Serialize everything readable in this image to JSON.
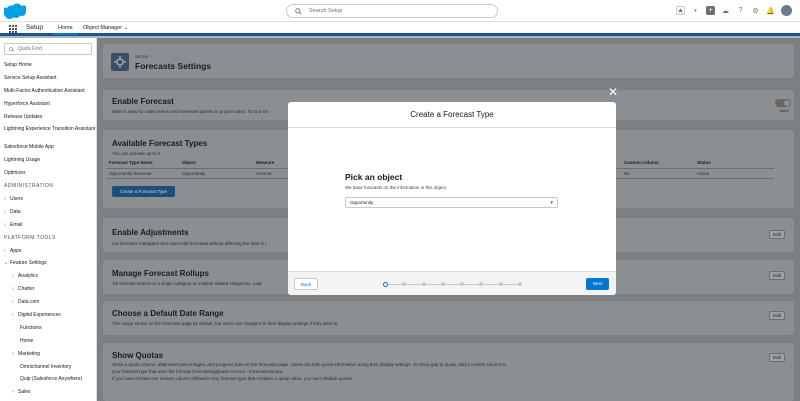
{
  "header": {
    "search_placeholder": "Search Setup"
  },
  "context_bar": {
    "app_name": "Setup",
    "tabs": [
      {
        "label": "Home"
      },
      {
        "label": "Object Manager"
      }
    ]
  },
  "sidebar": {
    "quick_find_placeholder": "Quick Find",
    "items": [
      {
        "label": "Setup Home"
      },
      {
        "label": "Service Setup Assistant"
      },
      {
        "label": "Multi-Factor Authentication Assistant"
      },
      {
        "label": "Hyperforce Assistant"
      },
      {
        "label": "Release Updates"
      },
      {
        "label": "Lightning Experience Transition Assistant"
      },
      {
        "label": "Salesforce Mobile App"
      },
      {
        "label": "Lightning Usage"
      },
      {
        "label": "Optimizer"
      }
    ],
    "section_admin": "ADMINISTRATION",
    "admin_items": [
      {
        "label": "Users"
      },
      {
        "label": "Data"
      },
      {
        "label": "Email"
      }
    ],
    "section_platform": "PLATFORM TOOLS",
    "platform_items": [
      {
        "label": "Apps"
      },
      {
        "label": "Feature Settings"
      }
    ],
    "feature_items": [
      {
        "label": "Analytics"
      },
      {
        "label": "Chatter"
      },
      {
        "label": "Data.com"
      },
      {
        "label": "Digital Experiences"
      },
      {
        "label": "Functions"
      },
      {
        "label": "Home"
      },
      {
        "label": "Marketing"
      },
      {
        "label": "Omnichannel Inventory"
      },
      {
        "label": "Quip (Salesforce Anywhere)"
      },
      {
        "label": "Sales"
      }
    ]
  },
  "page": {
    "kicker": "SETUP",
    "title": "Forecasts Settings"
  },
  "sections": {
    "enable_forecast": {
      "title": "Enable Forecast",
      "desc": "Make it easy for sales teams and interested parties to project sales. To turn On",
      "toggle_label": "Active"
    },
    "forecast_types": {
      "title": "Available Forecast Types",
      "desc": "You can activate up to 4.",
      "columns": [
        "Forecast Type Name",
        "Object",
        "Measure",
        "Custom Column",
        "Status"
      ],
      "rows": [
        [
          "Opportunity Revenue",
          "Opportunity",
          "Amount",
          "No",
          "Active"
        ]
      ],
      "create_button": "Create a Forecast Type"
    },
    "adjustments": {
      "title": "Enable Adjustments",
      "desc": "Let forecasts managers and users edit forecasts without affecting the data in t",
      "edit": "Edit"
    },
    "rollups": {
      "title": "Manage Forecast Rollups",
      "desc": "Tie forecast metrics to a single category or multiple related categories. Lear",
      "edit": "Edit"
    },
    "date_range": {
      "title": "Choose a Default Date Range",
      "desc": "This range shows on the forecasts page by default, but users can change it in their display settings if they want to.",
      "edit": "Edit"
    },
    "quotas": {
      "title": "Show Quotas",
      "desc1": "Show a quota column, attainment percentages, and progress bars on the forecasts page. Users can hide quota information using their display settings. To show gap to quota, add a custom column to",
      "desc2": "your forecast type that uses the formula ForecastingQuota:Amount - ForecastAmount.",
      "desc3": "If you have at least one custom column defined in any forecast type that contains a quote value, you can't disable quotas.",
      "edit": "Edit"
    }
  },
  "modal": {
    "close_glyph": "✕",
    "title": "Create a Forecast Type",
    "heading": "Pick an object",
    "description": "We base forecasts on the information in this object.",
    "selected_object": "Opportunity",
    "back_label": "Back",
    "next_label": "Next",
    "progress": {
      "current_step": 1,
      "total_steps": 8
    }
  },
  "colors": {
    "brand": "#0176d3",
    "header_stripe": "#1b5297",
    "logo": "#00a1e0"
  }
}
